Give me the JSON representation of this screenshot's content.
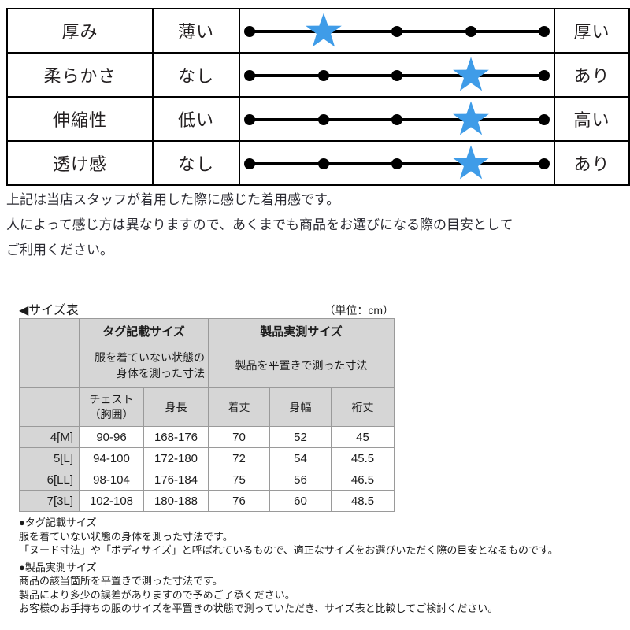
{
  "rating": {
    "rows": [
      {
        "label": "厚み",
        "left": "薄い",
        "right": "厚い",
        "value": 2,
        "max": 5
      },
      {
        "label": "柔らかさ",
        "left": "なし",
        "right": "あり",
        "value": 4,
        "max": 5
      },
      {
        "label": "伸縮性",
        "left": "低い",
        "right": "高い",
        "value": 4,
        "max": 5
      },
      {
        "label": "透け感",
        "left": "なし",
        "right": "あり",
        "value": 4,
        "max": 5
      }
    ],
    "star_color": "#3f9ce8",
    "dot_color": "#000000"
  },
  "disclaimer": {
    "line1": "上記は当店スタッフが着用した際に感じた着用感です。",
    "line2": "人によって感じ方は異なりますので、あくまでも商品をお選びになる際の目安として",
    "line3": "ご利用ください。"
  },
  "size_section": {
    "heading": "◀サイズ表",
    "unit_note": "（単位：cm）",
    "header": {
      "group_tag": "タグ記載サイズ",
      "group_product": "製品実測サイズ",
      "desc_tag_line1": "服を着ていない状態の",
      "desc_tag_line2": "身体を測った寸法",
      "desc_product": "製品を平置きで測った寸法",
      "col_chest_line1": "チェスト",
      "col_chest_line2": "（胸囲）",
      "col_height": "身長",
      "col_length": "着丈",
      "col_width": "身幅",
      "col_sleeve": "裄丈"
    },
    "rows": [
      {
        "size": "4[M]",
        "chest": "90-96",
        "height": "168-176",
        "length": "70",
        "width": "52",
        "sleeve": "45"
      },
      {
        "size": "5[L]",
        "chest": "94-100",
        "height": "172-180",
        "length": "72",
        "width": "54",
        "sleeve": "45.5"
      },
      {
        "size": "6[LL]",
        "chest": "98-104",
        "height": "176-184",
        "length": "75",
        "width": "56",
        "sleeve": "46.5"
      },
      {
        "size": "7[3L]",
        "chest": "102-108",
        "height": "180-188",
        "length": "76",
        "width": "60",
        "sleeve": "48.5"
      }
    ]
  },
  "notes": {
    "tag_title": "●タグ記載サイズ",
    "tag_line1": "服を着ていない状態の身体を測った寸法です。",
    "tag_line2": "「ヌード寸法」や「ボディサイズ」と呼ばれているもので、適正なサイズをお選びいただく際の目安となるものです。",
    "product_title": "●製品実測サイズ",
    "product_line1": "商品の該当箇所を平置きで測った寸法です。",
    "product_line2": "製品により多少の誤差がありますので予めご了承ください。",
    "product_line3": "お客様のお手持ちの服のサイズを平置きの状態で測っていただき、サイズ表と比較してご検討ください。"
  }
}
